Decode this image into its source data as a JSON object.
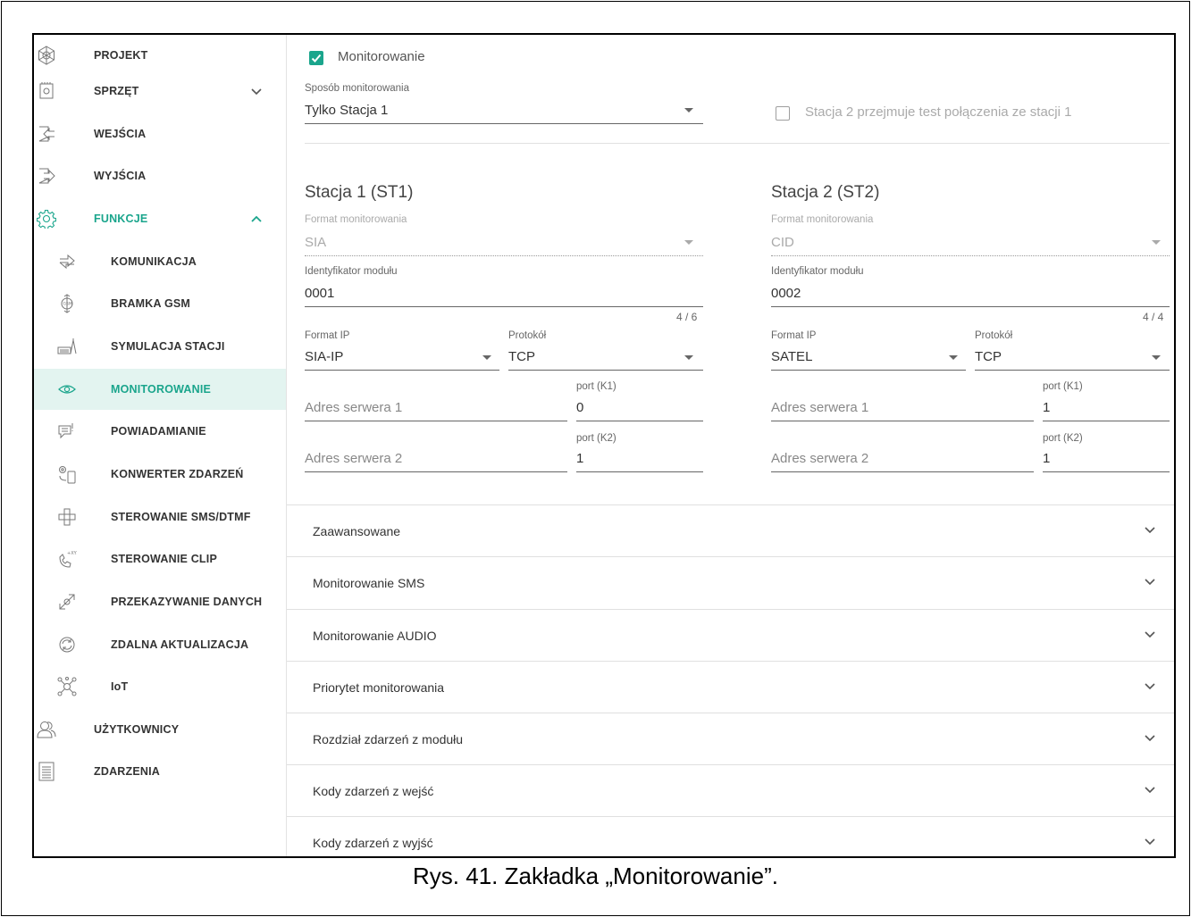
{
  "caption": "Rys. 41. Zakładka „Monitorowanie”.",
  "sidebar": {
    "items": [
      {
        "label": "PROJEKT"
      },
      {
        "label": "SPRZĘT"
      },
      {
        "label": "WEJŚCIA"
      },
      {
        "label": "WYJŚCIA"
      },
      {
        "label": "FUNKCJE"
      },
      {
        "label": "KOMUNIKACJA"
      },
      {
        "label": "BRAMKA GSM"
      },
      {
        "label": "SYMULACJA STACJI"
      },
      {
        "label": "MONITOROWANIE"
      },
      {
        "label": "POWIADAMIANIE"
      },
      {
        "label": "KONWERTER ZDARZEŃ"
      },
      {
        "label": "STEROWANIE SMS/DTMF"
      },
      {
        "label": "STEROWANIE CLIP"
      },
      {
        "label": "PRZEKAZYWANIE DANYCH"
      },
      {
        "label": "ZDALNA AKTUALIZACJA"
      },
      {
        "label": "IoT"
      },
      {
        "label": "UŻYTKOWNICY"
      },
      {
        "label": "ZDARZENIA"
      }
    ],
    "accent_color": "#1aa58c",
    "active_bg": "#e3f4f0"
  },
  "monitoring": {
    "enabled_label": "Monitorowanie",
    "enabled": true,
    "mode_label": "Sposób monitorowania",
    "mode_value": "Tylko Stacja 1",
    "takeover_label": "Stacja 2 przejmuje test połączenia ze stacji 1",
    "takeover_checked": false
  },
  "stations": [
    {
      "title": "Stacja 1 (ST1)",
      "format_label": "Format monitorowania",
      "format_value": "SIA",
      "id_label": "Identyfikator modułu",
      "id_value": "0001",
      "id_counter": "4 / 6",
      "ip_format_label": "Format IP",
      "ip_format_value": "SIA-IP",
      "protocol_label": "Protokół",
      "protocol_value": "TCP",
      "server1_placeholder": "Adres serwera 1",
      "port1_label": "port (K1)",
      "port1_value": "0",
      "server2_placeholder": "Adres serwera 2",
      "port2_label": "port (K2)",
      "port2_value": "1"
    },
    {
      "title": "Stacja 2 (ST2)",
      "format_label": "Format monitorowania",
      "format_value": "CID",
      "id_label": "Identyfikator modułu",
      "id_value": "0002",
      "id_counter": "4 / 4",
      "ip_format_label": "Format IP",
      "ip_format_value": "SATEL",
      "protocol_label": "Protokół",
      "protocol_value": "TCP",
      "server1_placeholder": "Adres serwera 1",
      "port1_label": "port (K1)",
      "port1_value": "1",
      "server2_placeholder": "Adres serwera 2",
      "port2_label": "port (K2)",
      "port2_value": "1"
    }
  ],
  "accordions": [
    {
      "label": "Zaawansowane"
    },
    {
      "label": "Monitorowanie SMS"
    },
    {
      "label": "Monitorowanie AUDIO"
    },
    {
      "label": "Priorytet monitorowania"
    },
    {
      "label": "Rozdział zdarzeń z modułu"
    },
    {
      "label": "Kody zdarzeń z wejść"
    },
    {
      "label": "Kody zdarzeń z wyjść"
    }
  ]
}
